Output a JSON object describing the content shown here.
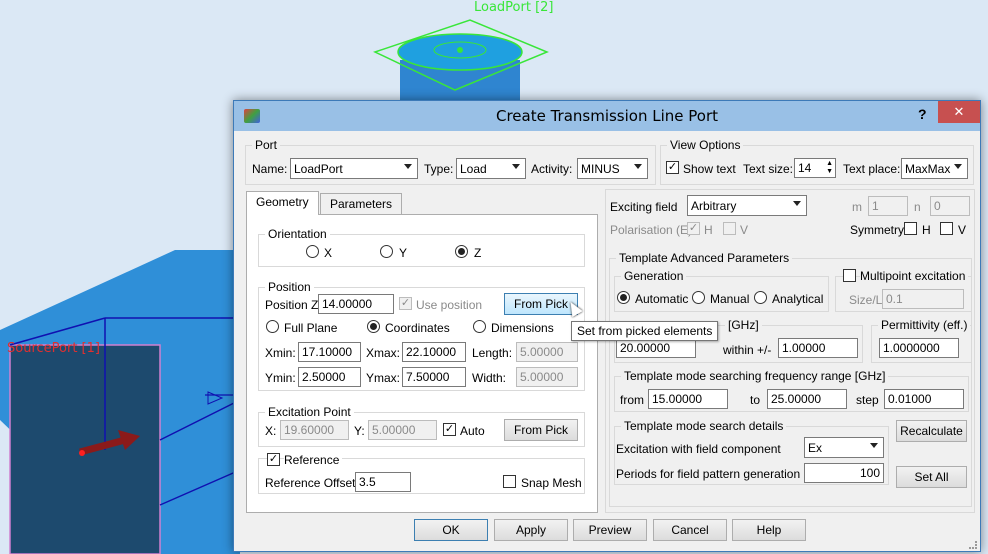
{
  "viewport": {
    "load_port_label": "LoadPort [2]",
    "source_port_label": "SourcePort [1]"
  },
  "dialog": {
    "title": "Create Transmission Line Port",
    "help_glyph": "?",
    "close_glyph": "✕",
    "port": {
      "legend": "Port",
      "name_label": "Name:",
      "name_value": "LoadPort",
      "type_label": "Type:",
      "type_value": "Load",
      "activity_label": "Activity:",
      "activity_value": "MINUS"
    },
    "view_options": {
      "legend": "View Options",
      "show_text_label": "Show text",
      "show_text_checked": true,
      "text_size_label": "Text size:",
      "text_size_value": "14",
      "text_place_label": "Text place:",
      "text_place_value": "MaxMax"
    },
    "tabs": [
      "Geometry",
      "Parameters"
    ],
    "geometry": {
      "orientation_legend": "Orientation",
      "orientation_options": [
        "X",
        "Y",
        "Z"
      ],
      "orientation_selected": "Z",
      "position_legend": "Position",
      "position_z_label": "Position Z",
      "position_z_value": "14.00000",
      "use_position_label": "Use position",
      "from_pick_label": "From Pick",
      "plane_options": [
        "Full Plane",
        "Coordinates",
        "Dimensions"
      ],
      "plane_selected": "Coordinates",
      "xmin_label": "Xmin:",
      "xmin_value": "17.10000",
      "xmax_label": "Xmax:",
      "xmax_value": "22.10000",
      "length_label": "Length:",
      "length_value": "5.00000",
      "ymin_label": "Ymin:",
      "ymin_value": "2.50000",
      "ymax_label": "Ymax:",
      "ymax_value": "7.50000",
      "width_label": "Width:",
      "width_value": "5.00000",
      "excitation_legend": "Excitation Point",
      "x_label": "X:",
      "x_value": "19.60000",
      "y_label": "Y:",
      "y_value": "5.00000",
      "auto_label": "Auto",
      "exc_from_pick_label": "From Pick",
      "reference_label": "Reference",
      "reference_offset_label": "Reference Offset",
      "reference_offset_value": "3.5",
      "snap_mesh_label": "Snap Mesh"
    },
    "tooltip": "Set from picked elements",
    "right": {
      "exciting_field_label": "Exciting field",
      "exciting_field_value": "Arbitrary",
      "m_label": "m",
      "m_value": "1",
      "n_label": "n",
      "n_value": "0",
      "polarisation_label": "Polarisation (E)",
      "pol_h_label": "H",
      "pol_v_label": "V",
      "symmetry_label": "Symmetry",
      "sym_h_label": "H",
      "sym_v_label": "V",
      "tap_legend": "Template Advanced Parameters",
      "generation_legend": "Generation",
      "generation_options": [
        "Automatic",
        "Manual",
        "Analytical"
      ],
      "generation_selected": "Automatic",
      "multipoint_label": "Multipoint excitation",
      "sizel_label": "Size/L",
      "sizel_value": "0.1",
      "freq_legend_visible": "[GHz]",
      "freq_value": "20.00000",
      "within_label": "within +/-",
      "within_value": "1.00000",
      "permittivity_legend": "Permittivity (eff.)",
      "permittivity_value": "1.0000000",
      "range_legend": "Template mode searching frequency range [GHz]",
      "from_label": "from",
      "from_value": "15.00000",
      "to_label": "to",
      "to_value": "25.00000",
      "step_label": "step",
      "step_value": "0.01000",
      "details_legend": "Template mode search details",
      "excitation_component_label": "Excitation with field component",
      "excitation_component_value": "Ex",
      "periods_label": "Periods for field pattern generation",
      "periods_value": "100",
      "recalculate_label": "Recalculate",
      "set_all_label": "Set All"
    },
    "buttons": [
      "OK",
      "Apply",
      "Preview",
      "Cancel",
      "Help"
    ]
  }
}
